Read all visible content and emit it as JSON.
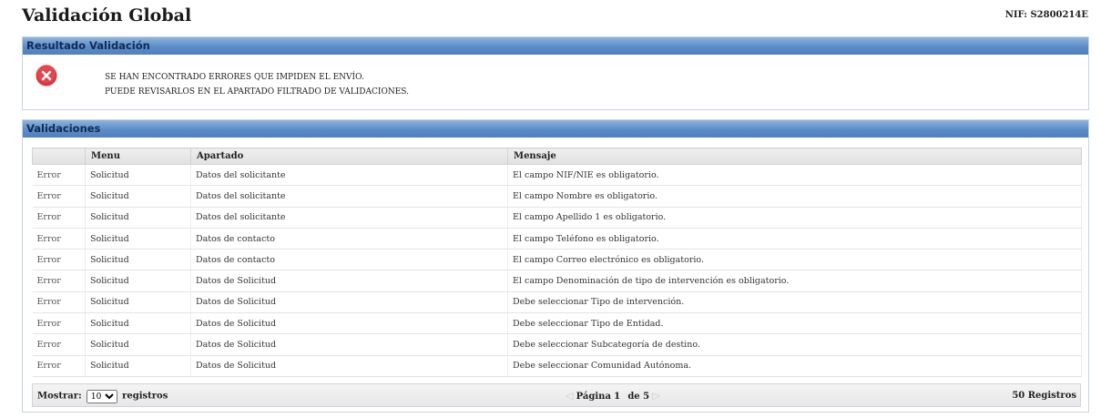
{
  "header": {
    "title": "Validación Global",
    "nif": "NIF: S2800214E"
  },
  "result": {
    "title": "Resultado Validación",
    "line1": "SE HAN ENCONTRADO ERRORES QUE IMPIDEN EL ENVÍO.",
    "line2": "PUEDE REVISARLOS EN EL APARTADO FILTRADO DE VALIDACIONES.",
    "icon": "error-x-icon",
    "icon_color": "#d9363e"
  },
  "validations": {
    "title": "Validaciones",
    "columns": [
      "",
      "Menu",
      "Apartado",
      "Mensaje"
    ],
    "rows": [
      [
        "Error",
        "Solicitud",
        "Datos del solicitante",
        "El campo NIF/NIE es obligatorio."
      ],
      [
        "Error",
        "Solicitud",
        "Datos del solicitante",
        "El campo Nombre es obligatorio."
      ],
      [
        "Error",
        "Solicitud",
        "Datos del solicitante",
        "El campo Apellido 1 es obligatorio."
      ],
      [
        "Error",
        "Solicitud",
        "Datos de contacto",
        "El campo Teléfono es obligatorio."
      ],
      [
        "Error",
        "Solicitud",
        "Datos de contacto",
        "El campo Correo electrónico es obligatorio."
      ],
      [
        "Error",
        "Solicitud",
        "Datos de Solicitud",
        "El campo Denominación de tipo de intervención es obligatorio."
      ],
      [
        "Error",
        "Solicitud",
        "Datos de Solicitud",
        "Debe seleccionar Tipo de intervención."
      ],
      [
        "Error",
        "Solicitud",
        "Datos de Solicitud",
        "Debe seleccionar Tipo de Entidad."
      ],
      [
        "Error",
        "Solicitud",
        "Datos de Solicitud",
        "Debe seleccionar Subcategoría de destino."
      ],
      [
        "Error",
        "Solicitud",
        "Datos de Solicitud",
        "Debe seleccionar Comunidad Autónoma."
      ]
    ]
  },
  "pager": {
    "show_label": "Mostrar:",
    "page_size": "10",
    "records_label": "registros",
    "page_label": "Página",
    "page_value": "1",
    "of_label": "de 5",
    "total": "50 Registros"
  },
  "colors": {
    "header_blue": "#5b8cc8",
    "header_text": "#0f2c55"
  }
}
